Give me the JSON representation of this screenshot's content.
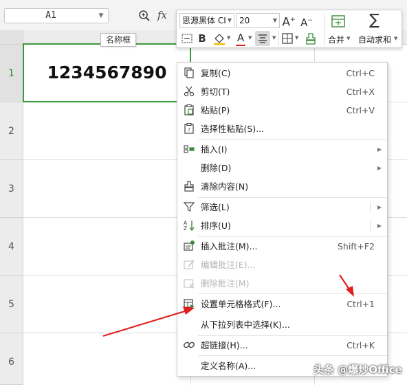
{
  "formula_bar": {
    "name_box_value": "A1",
    "fx_label": "fx"
  },
  "tooltip": "名称框",
  "grid": {
    "row_numbers": [
      "1",
      "2",
      "3",
      "4",
      "5",
      "6"
    ],
    "active_row": "1",
    "cell_value": "1234567890"
  },
  "mini_toolbar": {
    "font_name": "思源黑体 CI",
    "font_size": "20",
    "increase_font_icon_text": "A",
    "decrease_font_icon_text": "A",
    "bold_label": "B",
    "font_color_label": "A",
    "merge_label": "合并",
    "autosum_label": "自动求和",
    "autosum_symbol": "∑"
  },
  "context_menu": {
    "items": [
      {
        "label": "复制(C)",
        "shortcut": "Ctrl+C",
        "icon": "copy-icon"
      },
      {
        "label": "剪切(T)",
        "shortcut": "Ctrl+X",
        "icon": "scissors-icon"
      },
      {
        "label": "粘贴(P)",
        "shortcut": "Ctrl+V",
        "icon": "paste-icon"
      },
      {
        "label": "选择性粘贴(S)...",
        "shortcut": "",
        "icon": "paste-special-icon"
      },
      {
        "label": "插入(I)",
        "shortcut": "",
        "icon": "insert-icon"
      },
      {
        "label": "删除(D)",
        "shortcut": "",
        "icon": ""
      },
      {
        "label": "清除内容(N)",
        "shortcut": "",
        "icon": "eraser-icon"
      },
      {
        "label": "筛选(L)",
        "shortcut": "",
        "icon": "filter-icon"
      },
      {
        "label": "排序(U)",
        "shortcut": "",
        "icon": "sort-icon"
      },
      {
        "label": "插入批注(M)...",
        "shortcut": "Shift+F2",
        "icon": "insert-comment-icon"
      },
      {
        "label": "编辑批注(E)...",
        "shortcut": "",
        "icon": "edit-comment-icon"
      },
      {
        "label": "删除批注(M)",
        "shortcut": "",
        "icon": "delete-comment-icon"
      },
      {
        "label": "设置单元格格式(F)...",
        "shortcut": "Ctrl+1",
        "icon": "format-cells-icon"
      },
      {
        "label": "从下拉列表中选择(K)...",
        "shortcut": "",
        "icon": ""
      },
      {
        "label": "超链接(H)...",
        "shortcut": "Ctrl+K",
        "icon": "link-icon"
      },
      {
        "label": "定义名称(A)...",
        "shortcut": "",
        "icon": ""
      }
    ]
  },
  "watermark": "头条 @爆炒Office",
  "colors": {
    "active_green": "#3a9a3a",
    "font_color_red": "#e02020",
    "annotation_arrow": "#e02020"
  }
}
